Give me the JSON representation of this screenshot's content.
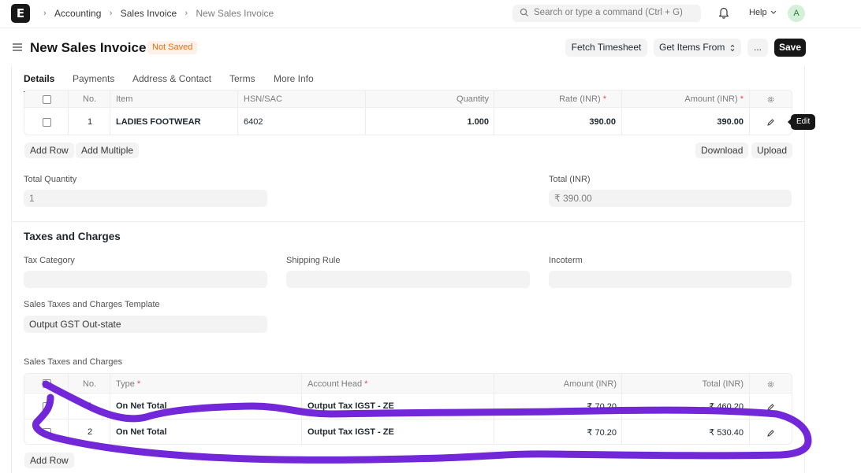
{
  "nav": {
    "breadcrumbs": [
      "Accounting",
      "Sales Invoice",
      "New Sales Invoice"
    ],
    "search_placeholder": "Search or type a command (Ctrl + G)",
    "help_label": "Help",
    "avatar_initial": "A"
  },
  "page": {
    "title": "New Sales Invoice",
    "status_badge": "Not Saved",
    "fetch_timesheet_label": "Fetch Timesheet",
    "get_items_label": "Get Items From",
    "more_label": "...",
    "save_label": "Save"
  },
  "tabs": [
    "Details",
    "Payments",
    "Address & Contact",
    "Terms",
    "More Info"
  ],
  "items_table": {
    "columns": {
      "no": "No.",
      "item": "Item",
      "hsn": "HSN/SAC",
      "qty": "Quantity",
      "rate": "Rate (INR)",
      "amount": "Amount (INR)"
    },
    "rows": [
      {
        "no": "1",
        "item": "LADIES FOOTWEAR",
        "hsn": "6402",
        "qty": "1.000",
        "rate": "390.00",
        "amount": "390.00"
      }
    ],
    "add_row_label": "Add Row",
    "add_multiple_label": "Add Multiple",
    "download_label": "Download",
    "upload_label": "Upload",
    "edit_tooltip": "Edit"
  },
  "totals": {
    "total_qty_label": "Total Quantity",
    "total_qty_value": "1",
    "total_label": "Total (INR)",
    "total_value": "₹ 390.00"
  },
  "taxes": {
    "section_title": "Taxes and Charges",
    "tax_category_label": "Tax Category",
    "shipping_rule_label": "Shipping Rule",
    "incoterm_label": "Incoterm",
    "template_label": "Sales Taxes and Charges Template",
    "template_value": "Output GST Out-state",
    "table_label": "Sales Taxes and Charges",
    "columns": {
      "no": "No.",
      "type": "Type",
      "account": "Account Head",
      "amount": "Amount (INR)",
      "total": "Total (INR)"
    },
    "rows": [
      {
        "no": "1",
        "type": "On Net Total",
        "account": "Output Tax IGST - ZE",
        "amount": "₹ 70.20",
        "total": "₹ 460.20"
      },
      {
        "no": "2",
        "type": "On Net Total",
        "account": "Output Tax IGST - ZE",
        "amount": "₹ 70.20",
        "total": "₹ 530.40"
      }
    ],
    "add_row_label": "Add Row"
  },
  "colors": {
    "accent": "#171717",
    "badge_text": "#e86c13",
    "badge_bg": "#fff1e7",
    "annotation": "#6a1bd6"
  }
}
